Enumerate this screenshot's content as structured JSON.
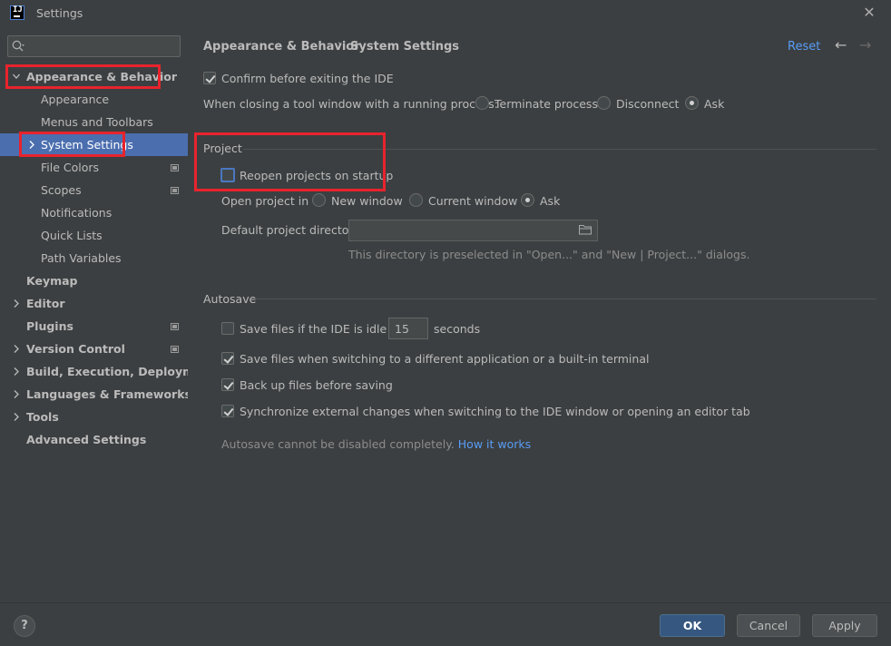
{
  "window": {
    "title": "Settings",
    "close_glyph": "✕",
    "app_icon_text": "IJ"
  },
  "search": {
    "placeholder": "",
    "icon": "search-icon"
  },
  "sidebar": {
    "items": [
      {
        "label": "Appearance & Behavior",
        "expanded": true
      },
      {
        "label": "Appearance"
      },
      {
        "label": "Menus and Toolbars"
      },
      {
        "label": "System Settings",
        "selected": true
      },
      {
        "label": "File Colors"
      },
      {
        "label": "Scopes"
      },
      {
        "label": "Notifications"
      },
      {
        "label": "Quick Lists"
      },
      {
        "label": "Path Variables"
      },
      {
        "label": "Keymap"
      },
      {
        "label": "Editor"
      },
      {
        "label": "Plugins"
      },
      {
        "label": "Version Control"
      },
      {
        "label": "Build, Execution, Deployment"
      },
      {
        "label": "Languages & Frameworks"
      },
      {
        "label": "Tools"
      },
      {
        "label": "Advanced Settings"
      }
    ]
  },
  "header": {
    "breadcrumb_parent": "Appearance & Behavior",
    "breadcrumb_sep": "›",
    "breadcrumb_current": "System Settings",
    "reset_label": "Reset",
    "back_glyph": "←",
    "forward_glyph": "→"
  },
  "general": {
    "confirm_exit_label": "Confirm before exiting the IDE",
    "confirm_exit_checked": true,
    "closing_label": "When closing a tool window with a running process:",
    "closing_options": [
      "Terminate process",
      "Disconnect",
      "Ask"
    ],
    "closing_selected": "Ask"
  },
  "project": {
    "section_title": "Project",
    "reopen_label": "Reopen projects on startup",
    "reopen_checked": false,
    "open_in_label": "Open project in",
    "open_in_options": [
      "New window",
      "Current window",
      "Ask"
    ],
    "open_in_selected": "Ask",
    "default_dir_label": "Default project directory:",
    "default_dir_value": "",
    "default_dir_hint": "This directory is preselected in \"Open...\" and \"New | Project...\" dialogs."
  },
  "autosave": {
    "section_title": "Autosave",
    "idle_label": "Save files if the IDE is idle for",
    "idle_checked": false,
    "idle_value": "15",
    "idle_unit": "seconds",
    "switch_app_label": "Save files when switching to a different application or a built-in terminal",
    "switch_app_checked": true,
    "backup_label": "Back up files before saving",
    "backup_checked": true,
    "sync_label": "Synchronize external changes when switching to the IDE window or opening an editor tab",
    "sync_checked": true,
    "note": "Autosave cannot be disabled completely.",
    "how_link": "How it works"
  },
  "footer": {
    "help_glyph": "?",
    "ok_label": "OK",
    "cancel_label": "Cancel",
    "apply_label": "Apply"
  },
  "colors": {
    "background": "#3c3f41",
    "selection": "#4b6eaf",
    "link": "#589df6",
    "highlight_box": "#e8232d",
    "ok_button": "#365880"
  }
}
